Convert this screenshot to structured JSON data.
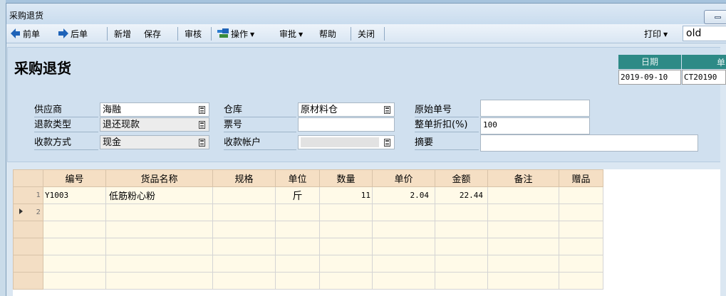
{
  "window": {
    "title": "采购退货",
    "minimize_label": "minimize-icon"
  },
  "toolbar": {
    "prev": "前单",
    "next": "后单",
    "new": "新增",
    "save": "保存",
    "audit": "审核",
    "operate": "操作",
    "approve": "审批",
    "help": "帮助",
    "close": "关闭",
    "print": "打印",
    "template_value": "old"
  },
  "doc": {
    "title": "采购退货",
    "date_label": "日期",
    "date_value": "2019-09-10",
    "number_value": "CT20190"
  },
  "form": {
    "supplier_label": "供应商",
    "supplier_value": "海融",
    "warehouse_label": "仓库",
    "warehouse_value": "原材料仓",
    "orig_no_label": "原始单号",
    "orig_no_value": "",
    "refund_type_label": "退款类型",
    "refund_type_value": "退还现款",
    "ticket_label": "票号",
    "ticket_value": "",
    "discount_label": "整单折扣(%)",
    "discount_value": "100",
    "pay_method_label": "收款方式",
    "pay_method_value": "现金",
    "account_label": "收款帐户",
    "account_value": "",
    "memo_label": "摘要",
    "memo_value": ""
  },
  "grid": {
    "columns": [
      "编号",
      "货品名称",
      "规格",
      "单位",
      "数量",
      "单价",
      "金额",
      "备注",
      "赠品"
    ],
    "rows": [
      {
        "n": "1",
        "code": "Y1003",
        "name": "低筋粉心粉",
        "spec": "",
        "unit": "斤",
        "qty": "11",
        "price": "2.04",
        "amount": "22.44",
        "note": "",
        "gift": ""
      },
      {
        "n": "2",
        "code": "",
        "name": "",
        "spec": "",
        "unit": "",
        "qty": "",
        "price": "",
        "amount": "",
        "note": "",
        "gift": ""
      }
    ]
  },
  "colors": {
    "header_teal": "#2d8a86",
    "grid_header": "#f5dfc4",
    "grid_row": "#fffae8",
    "arrow_blue": "#1e63b8"
  }
}
